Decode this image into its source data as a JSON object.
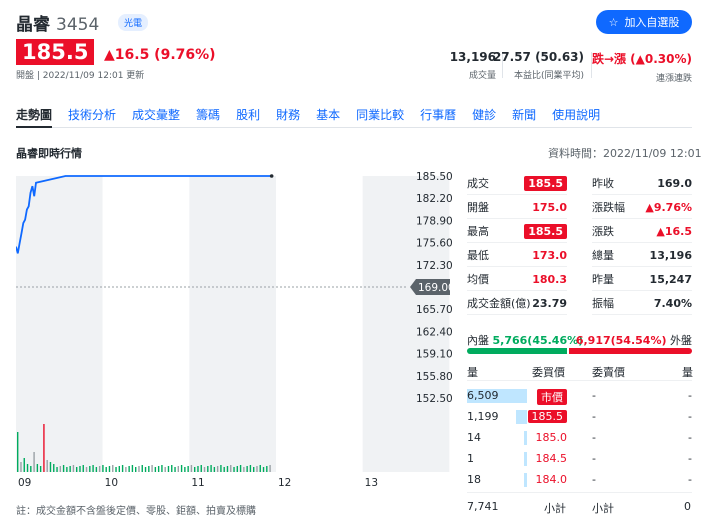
{
  "header": {
    "name": "晶睿",
    "code": "3454",
    "sector": "光電",
    "follow_label": "加入自選股",
    "price": "185.5",
    "change": "▲16.5 (9.76%)",
    "timestamp": "開盤 | 2022/11/09 12:01 更新"
  },
  "stats": [
    {
      "value": "13,196",
      "label": "成交量"
    },
    {
      "value": "27.57 (50.63)",
      "label": "本益比(同業平均)"
    },
    {
      "value": "跌→漲 (▲0.30%)",
      "label": "連漲連跌"
    }
  ],
  "tabs": [
    "走勢圖",
    "技術分析",
    "成交彙整",
    "籌碼",
    "股利",
    "財務",
    "基本",
    "同業比較",
    "行事曆",
    "健診",
    "新聞",
    "使用說明"
  ],
  "realtime": {
    "title": "晶睿即時行情",
    "time": "資料時間：2022/11/09 12:01"
  },
  "chart_data": {
    "type": "line",
    "x_ticks": [
      "09",
      "10",
      "11",
      "12",
      "13"
    ],
    "y_ticks": [
      "185.50",
      "182.20",
      "178.90",
      "175.60",
      "172.30",
      "169.00",
      "165.70",
      "162.40",
      "159.10",
      "155.80",
      "152.50"
    ],
    "ylim": [
      152.5,
      185.5
    ],
    "reference": "169.00",
    "series": [
      {
        "values": [
          175.0,
          174.0,
          175.5,
          177.0,
          178.5,
          179.0,
          180.5,
          181.0,
          183.0,
          184.0,
          182.5,
          184.5,
          185.5,
          185.5,
          185.5,
          185.5,
          185.5,
          185.5,
          185.5,
          185.5
        ]
      }
    ]
  },
  "quote": {
    "left": [
      {
        "k": "成交",
        "v": "185.5",
        "tag": true
      },
      {
        "k": "開盤",
        "v": "175.0",
        "color": "red"
      },
      {
        "k": "最高",
        "v": "185.5",
        "tag": true
      },
      {
        "k": "最低",
        "v": "173.0",
        "color": "red"
      },
      {
        "k": "均價",
        "v": "180.3",
        "color": "red"
      },
      {
        "k": "成交金額(億)",
        "v": "23.79"
      }
    ],
    "right": [
      {
        "k": "昨收",
        "v": "169.0"
      },
      {
        "k": "漲跌幅",
        "v": "▲9.76%",
        "color": "red"
      },
      {
        "k": "漲跌",
        "v": "▲16.5",
        "color": "red"
      },
      {
        "k": "總量",
        "v": "13,196"
      },
      {
        "k": "昨量",
        "v": "15,247"
      },
      {
        "k": "振幅",
        "v": "7.40%"
      }
    ]
  },
  "orderbook": {
    "inner_label": "內盤",
    "inner": "5,766(45.46%)",
    "outer": "6,917(54.54%)",
    "outer_label": "外盤",
    "inner_pct": 45.46,
    "headers": [
      "量",
      "委買價",
      "委賣價",
      "量"
    ],
    "rows": [
      {
        "qty": "6,509",
        "bid": "市價",
        "bar": 1.0,
        "tag": true,
        "ask": "-",
        "aq": "-"
      },
      {
        "qty": "1,199",
        "bid": "185.5",
        "bar": 0.18,
        "tag": true,
        "ask": "-",
        "aq": "-"
      },
      {
        "qty": "14",
        "bid": "185.0",
        "bar": 0.02,
        "ask": "-",
        "aq": "-"
      },
      {
        "qty": "1",
        "bid": "184.5",
        "bar": 0.005,
        "ask": "-",
        "aq": "-"
      },
      {
        "qty": "18",
        "bid": "184.0",
        "bar": 0.02,
        "ask": "-",
        "aq": "-"
      }
    ],
    "total_qty": "7,741",
    "subtotal": "小計",
    "ask_subtotal": "小計",
    "ask_total": "0"
  },
  "note": "註：成交金額不含盤後定價、零股、鉅額、拍賣及標購"
}
